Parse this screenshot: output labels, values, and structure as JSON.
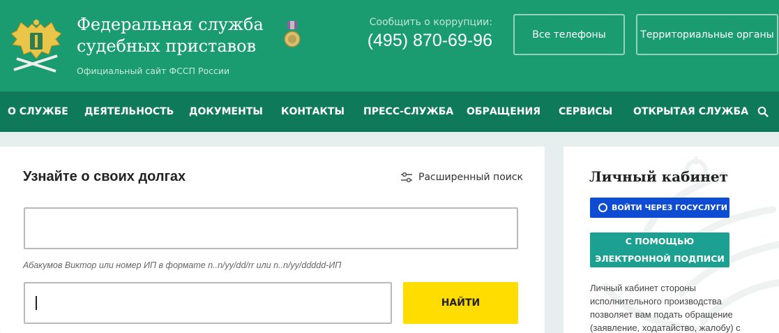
{
  "header": {
    "title_line1": "Федеральная служба",
    "title_line2": "судебных приставов",
    "subtitle": "Официальный сайт ФССП России",
    "corruption_label": "Сообщить о коррупции:",
    "corruption_phone": "(495) 870-69-96",
    "all_phones_label": "Все телефоны",
    "territorial_label": "Территориальные органы",
    "colors": {
      "header_bg": "#1a9c70",
      "nav_bg": "#0f7a5a"
    }
  },
  "nav": {
    "items": [
      "О СЛУЖБЕ",
      "ДЕЯТЕЛЬНОСТЬ",
      "ДОКУМЕНТЫ",
      "КОНТАКТЫ",
      "ПРЕСС-СЛУЖБА",
      "ОБРАЩЕНИЯ",
      "СЕРВИСЫ",
      "ОТКРЫТАЯ СЛУЖБА"
    ],
    "search_icon": "search-icon"
  },
  "debt_search": {
    "title": "Узнайте о своих долгах",
    "advanced_label": "Расширенный поиск",
    "advanced_icon": "sliders-icon",
    "input1_value": "",
    "hint": "Абакумов Виктор или номер ИП в формате n..n/yy/dd/rr или n..n/yy/ddddd-ИП",
    "input2_value": "",
    "find_label": "НАЙТИ",
    "find_color": "#ffdd00"
  },
  "cabinet": {
    "title": "Личный кабинет",
    "gosuslugi_label": "ВОЙТИ ЧЕРЕЗ ГОСУСЛУГИ",
    "gosuslugi_color": "#0d4cd3",
    "ep_label_line1": "С ПОМОЩЬЮ",
    "ep_label_line2": "ЭЛЕКТРОННОЙ ПОДПИСИ",
    "ep_color": "#1ba091",
    "description": "Личный кабинет стороны исполнительного производства позволяет вам подать обращение (заявление, ходатайство, жалобу) с"
  }
}
